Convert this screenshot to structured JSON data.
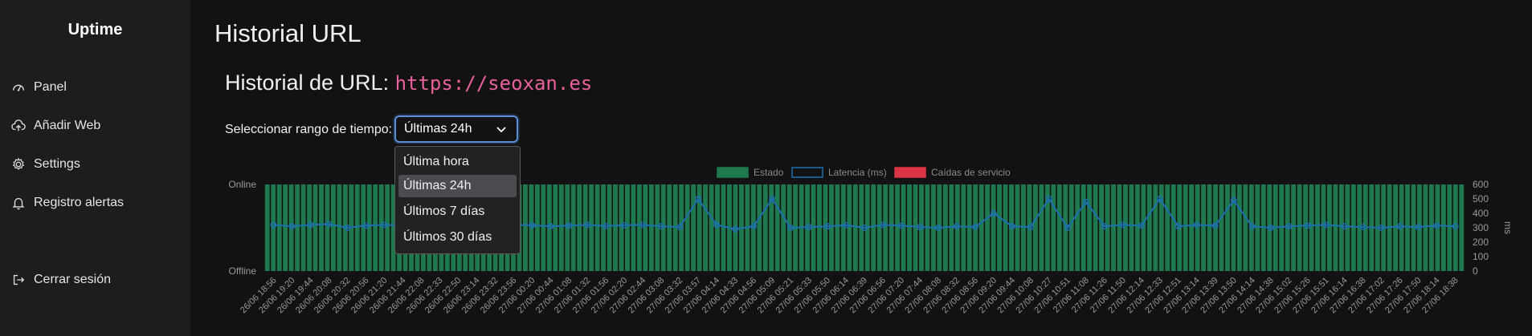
{
  "sidebar": {
    "brand": "Uptime",
    "items": [
      {
        "label": "Panel",
        "icon": "gauge-icon"
      },
      {
        "label": "Añadir Web",
        "icon": "cloud-upload-icon"
      },
      {
        "label": "Settings",
        "icon": "gear-icon"
      },
      {
        "label": "Registro alertas",
        "icon": "bell-icon"
      },
      {
        "label": "Cerrar sesión",
        "icon": "logout-icon"
      }
    ]
  },
  "header": {
    "title": "Historial URL",
    "url_prefix": "Historial de URL: ",
    "url": "https://seoxan.es"
  },
  "range": {
    "label": "Seleccionar rango de tiempo:",
    "selected": "Últimas 24h",
    "options": [
      "Última hora",
      "Últimas 24h",
      "Últimos 7 días",
      "Últimos 30 días"
    ]
  },
  "colors": {
    "estado": "#1e7a4e",
    "latencia": "#1d6fb0",
    "caidas": "#dc3545",
    "select_border": "#5b8fd6",
    "url_text": "#e8609d"
  },
  "chart_data": {
    "type": "bar",
    "legend": [
      "Estado",
      "Latencia (ms)",
      "Caídas de servicio"
    ],
    "legend_position": "top",
    "ylabel_left": [
      "Online",
      "Offline"
    ],
    "ylabel_right": "ms",
    "ylim_right": [
      0,
      600
    ],
    "right_ticks": [
      "600",
      "500",
      "400",
      "300",
      "200",
      "100",
      "0"
    ],
    "categories": [
      "26/06 18:56",
      "26/06 19:20",
      "26/06 19:44",
      "26/06 20:08",
      "26/06 20:32",
      "26/06 20:56",
      "26/06 21:20",
      "26/06 21:44",
      "26/06 22:08",
      "26/06 22:33",
      "26/06 22:50",
      "26/06 23:14",
      "26/06 23:32",
      "26/06 23:56",
      "27/06 00:20",
      "27/06 00:44",
      "27/06 01:08",
      "27/06 01:32",
      "27/06 01:56",
      "27/06 02:20",
      "27/06 02:44",
      "27/06 03:08",
      "27/06 03:32",
      "27/06 03:57",
      "27/06 04:14",
      "27/06 04:33",
      "27/06 04:56",
      "27/06 05:09",
      "27/06 05:21",
      "27/06 05:33",
      "27/06 05:50",
      "27/06 06:14",
      "27/06 06:39",
      "27/06 06:56",
      "27/06 07:20",
      "27/06 07:44",
      "27/06 08:08",
      "27/06 08:32",
      "27/06 08:56",
      "27/06 09:20",
      "27/06 09:44",
      "27/06 10:08",
      "27/06 10:27",
      "27/06 10:51",
      "27/06 11:08",
      "27/06 11:26",
      "27/06 11:50",
      "27/06 12:14",
      "27/06 12:33",
      "27/06 12:51",
      "27/06 13:14",
      "27/06 13:39",
      "27/06 13:50",
      "27/06 14:14",
      "27/06 14:38",
      "27/06 15:02",
      "27/06 15:26",
      "27/06 15:51",
      "27/06 16:14",
      "27/06 16:38",
      "27/06 17:02",
      "27/06 17:26",
      "27/06 17:50",
      "27/06 18:14",
      "27/06 18:38"
    ],
    "estado_values": [
      1,
      1,
      1,
      1,
      1,
      1,
      1,
      1,
      1,
      1,
      1,
      1,
      1,
      1,
      1,
      1,
      1,
      1,
      1,
      1,
      1,
      1,
      1,
      1,
      1,
      1,
      1,
      1,
      1,
      1,
      1,
      1,
      1,
      1,
      1,
      1,
      1,
      1,
      1,
      1,
      1,
      1,
      1,
      1,
      1,
      1,
      1,
      1,
      1,
      1,
      1,
      1,
      1,
      1,
      1,
      1,
      1,
      1,
      1,
      1,
      1,
      1,
      1,
      1,
      1
    ],
    "latency_values": [
      320,
      310,
      320,
      325,
      300,
      315,
      320,
      318,
      310,
      320,
      305,
      315,
      312,
      320,
      318,
      310,
      315,
      320,
      312,
      318,
      320,
      310,
      305,
      500,
      320,
      290,
      310,
      500,
      300,
      305,
      310,
      318,
      300,
      320,
      315,
      305,
      300,
      310,
      305,
      400,
      310,
      305,
      500,
      300,
      480,
      310,
      320,
      315,
      500,
      310,
      320,
      315,
      490,
      310,
      300,
      310,
      315,
      320,
      310,
      305,
      300,
      310,
      305,
      315,
      310
    ]
  }
}
